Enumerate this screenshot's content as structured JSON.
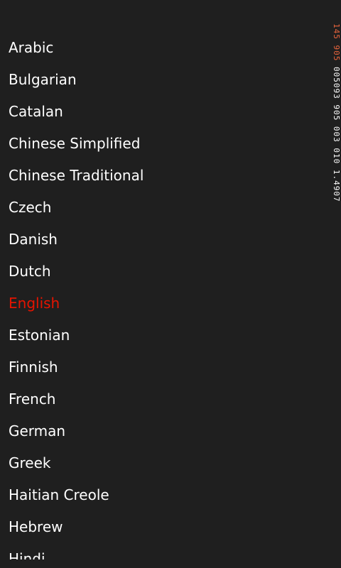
{
  "languages": [
    {
      "label": "Arabic"
    },
    {
      "label": "Bulgarian"
    },
    {
      "label": "Catalan"
    },
    {
      "label": "Chinese Simplified"
    },
    {
      "label": "Chinese Traditional"
    },
    {
      "label": "Czech"
    },
    {
      "label": "Danish"
    },
    {
      "label": "Dutch"
    },
    {
      "label": "English",
      "selected": true
    },
    {
      "label": "Estonian"
    },
    {
      "label": "Finnish"
    },
    {
      "label": "French"
    },
    {
      "label": "German"
    },
    {
      "label": "Greek"
    },
    {
      "label": "Haitian Creole"
    },
    {
      "label": "Hebrew"
    },
    {
      "label": "Hindi"
    }
  ],
  "perf_counter": {
    "segments": [
      {
        "text": "145",
        "color": "red"
      },
      {
        "text": " 905",
        "color": "red"
      },
      {
        "text": " 005093 905 003 010 1.4907",
        "color": "white"
      }
    ]
  },
  "colors": {
    "background": "#1f1f1f",
    "text": "#ffffff",
    "accent": "#e51400",
    "counter_red": "#e8643c"
  }
}
